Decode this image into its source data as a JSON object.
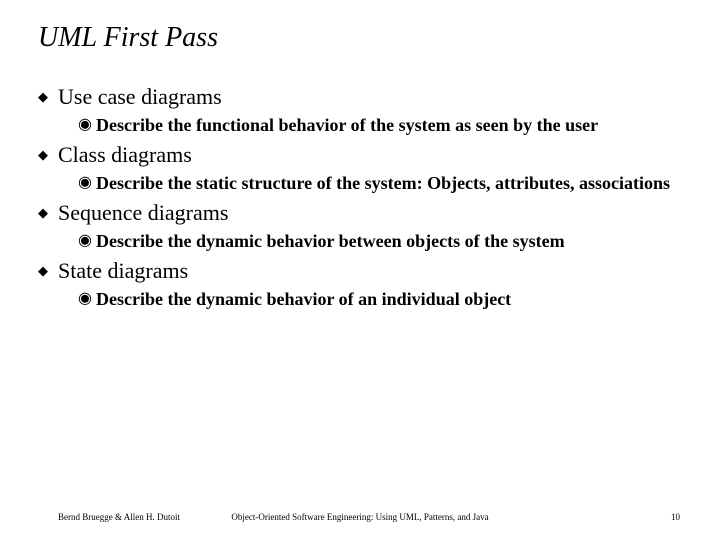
{
  "title": "UML First Pass",
  "items": [
    {
      "label": "Use case diagrams",
      "sub": [
        "Describe the functional behavior of the system as seen by the user"
      ]
    },
    {
      "label": "Class diagrams",
      "sub": [
        "Describe the static structure of the system: Objects, attributes, associations"
      ]
    },
    {
      "label": "Sequence diagrams",
      "sub": [
        "Describe the dynamic behavior between objects of the system"
      ]
    },
    {
      "label": "State diagrams",
      "sub": [
        "Describe the dynamic behavior of an individual object"
      ]
    }
  ],
  "footer": {
    "left": "Bernd Bruegge & Allen H. Dutoit",
    "center": "Object-Oriented Software Engineering: Using UML, Patterns, and Java",
    "right": "10"
  },
  "bullets": {
    "l1": "◆",
    "l2": "◉"
  }
}
